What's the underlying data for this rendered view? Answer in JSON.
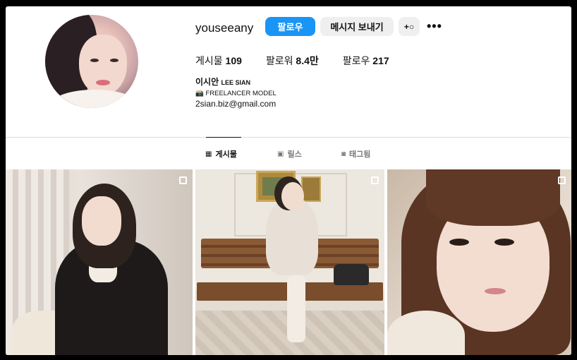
{
  "profile": {
    "username": "youseeany",
    "follow_label": "팔로우",
    "message_label": "메시지 보내기",
    "add_user_icon": "+",
    "more_icon": "•••"
  },
  "stats": {
    "posts_label": "게시물",
    "posts_value": "109",
    "followers_label": "팔로워",
    "followers_value": "8.4만",
    "following_label": "팔로우",
    "following_value": "217"
  },
  "bio": {
    "name": "이시안",
    "name_en": "LEE SIAN",
    "tagline": "📸 FREELANCER MODEL",
    "email": "2sian.biz@gmail.com"
  },
  "tabs": [
    {
      "label": "게시물",
      "icon": "grid-icon",
      "glyph": "▦"
    },
    {
      "label": "릴스",
      "icon": "reels-icon",
      "glyph": "▣"
    },
    {
      "label": "태그됨",
      "icon": "tagged-icon",
      "glyph": "◙"
    }
  ],
  "colors": {
    "accent": "#1a95f5",
    "button_secondary": "#efefef"
  }
}
